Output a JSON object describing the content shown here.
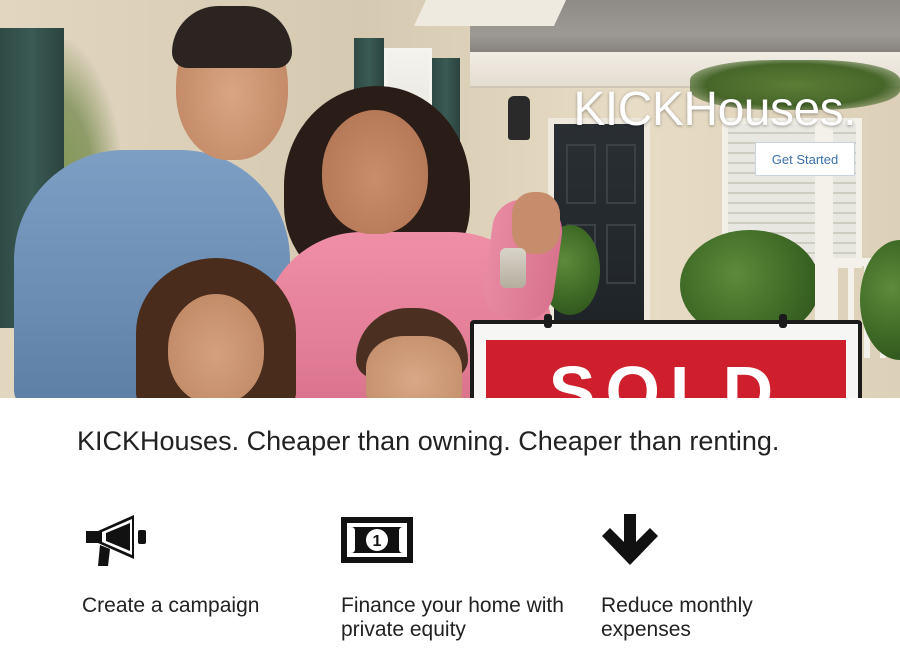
{
  "hero": {
    "brand": "KICKHouses.",
    "cta_label": "Get Started",
    "sign_text": "SOLD"
  },
  "tagline": "KICKHouses. Cheaper than owning. Cheaper than renting.",
  "features": [
    {
      "icon": "megaphone-icon",
      "label": "Create a campaign"
    },
    {
      "icon": "money-bill-icon",
      "label": "Finance your home with private equity"
    },
    {
      "icon": "arrow-down-icon",
      "label": "Reduce monthly expenses"
    }
  ],
  "colors": {
    "cta_text": "#3d6fa8",
    "sign_red": "#cf1e2c",
    "text": "#222222"
  }
}
